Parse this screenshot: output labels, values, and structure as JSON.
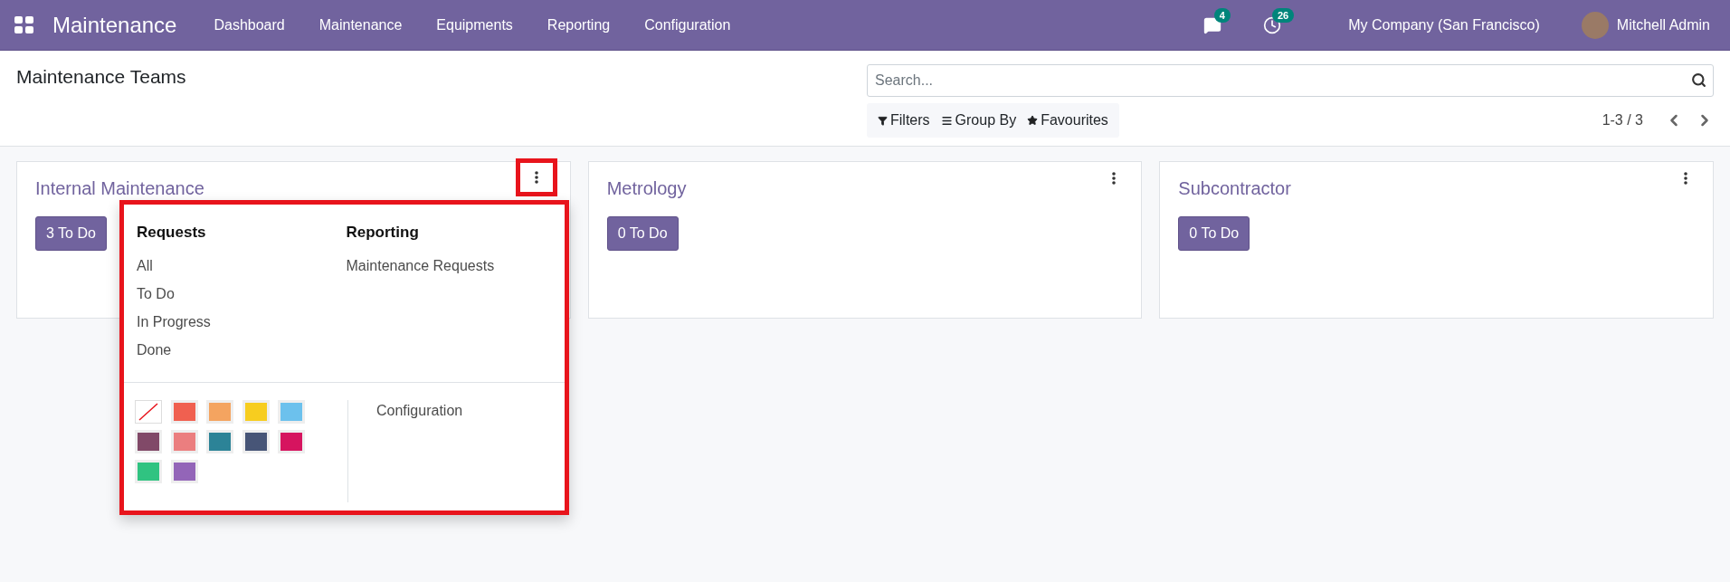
{
  "navbar": {
    "app_name": "Maintenance",
    "menu": [
      "Dashboard",
      "Maintenance",
      "Equipments",
      "Reporting",
      "Configuration"
    ],
    "messages_count": "4",
    "activities_count": "26",
    "company": "My Company (San Francisco)",
    "user": "Mitchell Admin"
  },
  "control_panel": {
    "title": "Maintenance Teams",
    "search": {
      "placeholder": "Search..."
    },
    "filters": [
      "Filters",
      "Group By",
      "Favourites"
    ],
    "pager": "1-3 / 3"
  },
  "teams": [
    {
      "name": "Internal Maintenance",
      "todo": "3 To Do",
      "menu_open": true
    },
    {
      "name": "Metrology",
      "todo": "0 To Do",
      "menu_open": false
    },
    {
      "name": "Subcontractor",
      "todo": "0 To Do",
      "menu_open": false
    }
  ],
  "dropdown": {
    "sections": [
      {
        "title": "Requests",
        "items": [
          "All",
          "To Do",
          "In Progress",
          "Done"
        ]
      },
      {
        "title": "Reporting",
        "items": [
          "Maintenance Requests"
        ]
      }
    ],
    "colors": [
      {
        "kind": "none"
      },
      {
        "kind": "swatch",
        "color": "#f06050"
      },
      {
        "kind": "swatch",
        "color": "#f4a460"
      },
      {
        "kind": "swatch",
        "color": "#f7cd1f"
      },
      {
        "kind": "swatch",
        "color": "#6cc1ed"
      },
      {
        "kind": "swatch",
        "color": "#814968"
      },
      {
        "kind": "swatch",
        "color": "#eb7e7f"
      },
      {
        "kind": "swatch",
        "color": "#2c8397"
      },
      {
        "kind": "swatch",
        "color": "#475577"
      },
      {
        "kind": "swatch",
        "color": "#d6145f"
      },
      {
        "kind": "swatch",
        "color": "#30c381"
      },
      {
        "kind": "swatch",
        "color": "#9365b8"
      }
    ],
    "settings_link": "Configuration"
  }
}
